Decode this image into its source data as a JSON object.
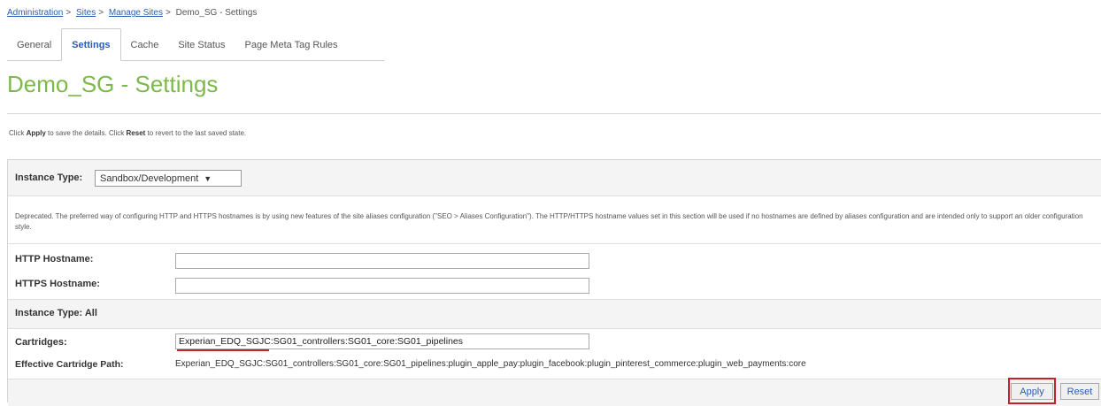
{
  "breadcrumb": {
    "items": [
      "Administration",
      "Sites",
      "Manage Sites"
    ],
    "current": "Demo_SG - Settings",
    "separator": ">"
  },
  "tabs": [
    "General",
    "Settings",
    "Cache",
    "Site Status",
    "Page Meta Tag Rules"
  ],
  "active_tab": "Settings",
  "page_title": "Demo_SG - Settings",
  "help": {
    "p1": "Click ",
    "apply": "Apply",
    "p2": " to save the details. Click ",
    "reset": "Reset",
    "p3": " to revert to the last saved state."
  },
  "instance_type": {
    "label": "Instance Type:",
    "selected": "Sandbox/Development"
  },
  "deprecated_text": "Deprecated. The preferred way of configuring HTTP and HTTPS hostnames is by using new features of the site aliases configuration (\"SEO > Aliases Configuration\"). The HTTP/HTTPS hostname values set in this section will be used if no hostnames are defined by aliases configuration and are intended only to support an older configuration style.",
  "http_hostname": {
    "label": "HTTP Hostname:",
    "value": ""
  },
  "https_hostname": {
    "label": "HTTPS Hostname:",
    "value": ""
  },
  "instance_type_all": "Instance Type:  All",
  "cartridges": {
    "label": "Cartridges:",
    "value": "Experian_EDQ_SGJC:SG01_controllers:SG01_core:SG01_pipelines"
  },
  "effective_path": {
    "label": "Effective Cartridge Path:",
    "value": "Experian_EDQ_SGJC:SG01_controllers:SG01_core:SG01_pipelines:plugin_apple_pay:plugin_facebook:plugin_pinterest_commerce:plugin_web_payments:core"
  },
  "buttons": {
    "apply": "Apply",
    "reset": "Reset"
  },
  "colors": {
    "title_green": "#7db94a",
    "link_blue": "#2a5db0",
    "highlight_red": "#c8202a"
  }
}
